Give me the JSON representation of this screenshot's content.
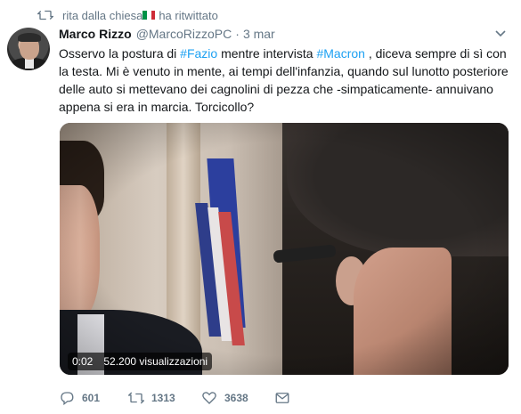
{
  "retweet_context": {
    "user": "rita dalla chiesa",
    "action": "ha ritwittato",
    "flag_colors": [
      "#009246",
      "#ffffff",
      "#ce2b37"
    ]
  },
  "tweet": {
    "author_name": "Marco Rizzo",
    "author_handle": "@MarcoRizzoPC",
    "separator": "·",
    "date": "3 mar",
    "text_parts": {
      "p1": "Osservo la postura di ",
      "hashtag1": "#Fazio",
      "p2": " mentre intervista ",
      "hashtag2": "#Macron",
      "p3": " , diceva sempre di sì con la testa. Mi è venuto in mente, ai tempi dell'infanzia, quando sul lunotto posteriore delle auto si mettevano dei cagnolini di pezza che -simpaticamente- annuivano appena si era in marcia. Torcicollo?"
    }
  },
  "video": {
    "time": "0:02",
    "views": "52.200 visualizzazioni"
  },
  "actions": {
    "reply_count": "601",
    "retweet_count": "1313",
    "like_count": "3638",
    "icons": [
      "reply-icon",
      "retweet-icon",
      "like-icon",
      "direct-message-icon"
    ]
  },
  "colors": {
    "text_primary": "#14171a",
    "text_secondary": "#657786",
    "link": "#1da1f2"
  }
}
